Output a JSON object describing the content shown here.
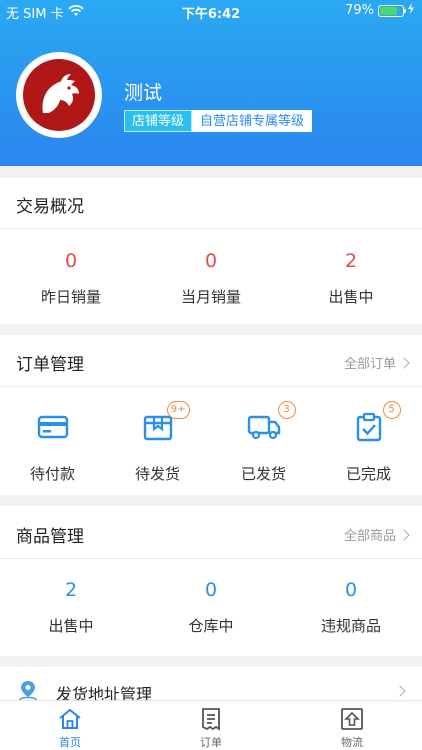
{
  "status_bar": {
    "carrier": "无 SIM 卡",
    "time": "下午6:42",
    "battery_percent": "79%",
    "battery_level": 0.79
  },
  "profile": {
    "shop_name": "测试",
    "level_label": "店铺等级",
    "exclusive_level_label": "自营店铺专属等级"
  },
  "trade_overview": {
    "title": "交易概况",
    "stats": [
      {
        "value": "0",
        "label": "昨日销量"
      },
      {
        "value": "0",
        "label": "当月销量"
      },
      {
        "value": "2",
        "label": "出售中"
      }
    ]
  },
  "order_management": {
    "title": "订单管理",
    "link": "全部订单",
    "items": [
      {
        "label": "待付款",
        "icon": "card-icon",
        "badge": ""
      },
      {
        "label": "待发货",
        "icon": "package-icon",
        "badge": "9+"
      },
      {
        "label": "已发货",
        "icon": "truck-icon",
        "badge": "3"
      },
      {
        "label": "已完成",
        "icon": "clipboard-check-icon",
        "badge": "5"
      }
    ]
  },
  "product_management": {
    "title": "商品管理",
    "link": "全部商品",
    "stats": [
      {
        "value": "2",
        "label": "出售中"
      },
      {
        "value": "0",
        "label": "仓库中"
      },
      {
        "value": "0",
        "label": "违规商品"
      }
    ]
  },
  "shipping_address": {
    "label": "发货地址管理",
    "icon": "location-pin-icon"
  },
  "tab_bar": [
    {
      "label": "首页",
      "icon": "home-icon",
      "active": true
    },
    {
      "label": "订单",
      "icon": "orders-icon",
      "active": false
    },
    {
      "label": "物流",
      "icon": "logistics-icon",
      "active": false
    }
  ],
  "colors": {
    "accent": "#2a86ee",
    "header_top": "#2aa9f2",
    "red": "#e84b4b",
    "badge": "#f08c3c"
  }
}
